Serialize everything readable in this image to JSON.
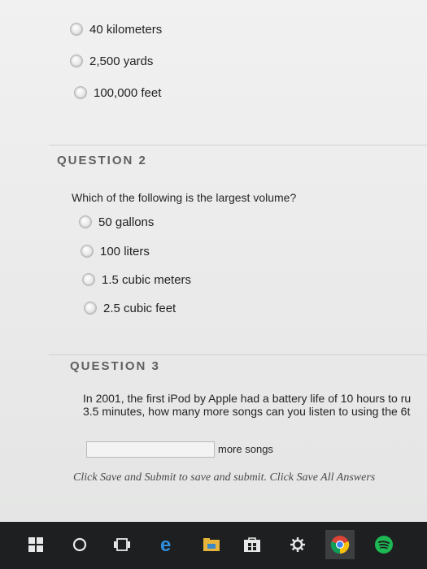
{
  "question1": {
    "options": [
      "40 kilometers",
      "2,500 yards",
      "100,000 feet"
    ]
  },
  "question2": {
    "title": "QUESTION 2",
    "text": "Which of the following is the largest volume?",
    "options": [
      "50 gallons",
      "100 liters",
      "1.5 cubic meters",
      "2.5 cubic feet"
    ]
  },
  "question3": {
    "title": "QUESTION 3",
    "text_line1": "In 2001, the first iPod by Apple had a battery life of 10 hours to ru",
    "text_line2": "3.5 minutes, how many more songs can you listen to using the 6t",
    "input_value": "",
    "input_suffix": "more songs"
  },
  "instructions": "Click Save and Submit to save and submit. Click Save All Answers",
  "taskbar": {
    "icons": [
      "windows-start-icon",
      "cortana-search-icon",
      "task-view-icon",
      "edge-browser-icon",
      "file-explorer-icon",
      "store-icon",
      "settings-icon",
      "chrome-icon",
      "spotify-icon"
    ]
  },
  "colors": {
    "taskbar": "#1d1f20",
    "question_title": "#5f6060",
    "edge_blue": "#2f8fe0",
    "spotify_green": "#1db954"
  }
}
